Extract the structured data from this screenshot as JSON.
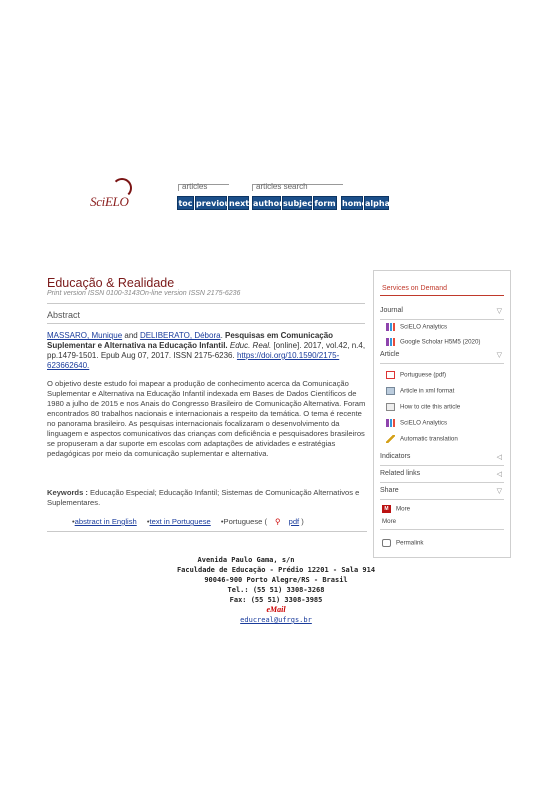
{
  "header": {
    "logo_text": "SciELO",
    "group_articles": "articles",
    "group_search": "articles search",
    "nav": [
      "toc",
      "previous",
      "next",
      "author",
      "subject",
      "form",
      "home",
      "alpha"
    ]
  },
  "journal": {
    "title": "Educação & Realidade",
    "issn": "Print version ISSN 0100-3143On-line version ISSN 2175-6236"
  },
  "abstract_heading": "Abstract",
  "citation": {
    "author1": "MASSARO, Munique",
    "and": " and ",
    "author2": "DELIBERATO, Débora",
    "title": "Pesquisas em Comunicação Suplementar e Alternativa na Educação Infantil.",
    "journal": "Educ. Real.",
    "details": " [online]. 2017, vol.42, n.4, pp.1479-1501.  Epub Aug 07, 2017. ISSN 2175-6236.  ",
    "doi": "https://doi.org/10.1590/2175-623662640."
  },
  "abstract_text": "O objetivo deste estudo foi mapear a produção de conhecimento acerca da Comunicação Suplementar e Alternativa na Educação Infantil indexada em Bases de Dados Científicos de 1980 a julho de 2015 e nos Anais do Congresso Brasileiro de Comunicação Alternativa. Foram encontrados 80 trabalhos nacionais e internacionais a respeito da temática. O tema é recente no panorama brasileiro. As pesquisas internacionais focalizaram o desenvolvimento da linguagem e aspectos comunicativos das crianças com deficiência e pesquisadores brasileiros se propuseram a dar suporte em escolas com adaptações de atividades e estratégias pedagógicas por meio da comunicação suplementar e alternativa.",
  "keywords": {
    "label": "Keywords :",
    "text": " Educação Especial; Educação Infantil; Sistemas de Comunicação Alternativos e Suplementares."
  },
  "links": {
    "abstract_english": "abstract in English",
    "text_portuguese": "text in Portuguese",
    "portuguese": "Portuguese (",
    "pdf": "pdf",
    "close": " )"
  },
  "footer": {
    "line1": "Avenida Paulo Gama, s/n",
    "line2": "Faculdade de Educação - Prédio 12201 - Sala 914",
    "line3": "90046-900 Porto Alegre/RS - Brasil",
    "line4": "Tel.: (55 51) 3308-3268",
    "line5": "Fax: (55 51) 3308-3985",
    "mail_icon": "eMail",
    "email": "educreal@ufrgs.br"
  },
  "sidebar": {
    "title": "Services on Demand",
    "journal": "Journal",
    "scielo_analytics": "SciELO Analytics",
    "google_scholar": "Google Scholar H5M5 (2020)",
    "article": "Article",
    "portuguese_pdf": "Portuguese (pdf)",
    "xml": "Article in xml format",
    "cite": "How to cite this article",
    "scielo_analytics2": "SciELO Analytics",
    "translation": "Automatic translation",
    "indicators": "Indicators",
    "related": "Related links",
    "share": "Share",
    "more1": "More",
    "more2": "More",
    "permalink": "Permalink"
  }
}
